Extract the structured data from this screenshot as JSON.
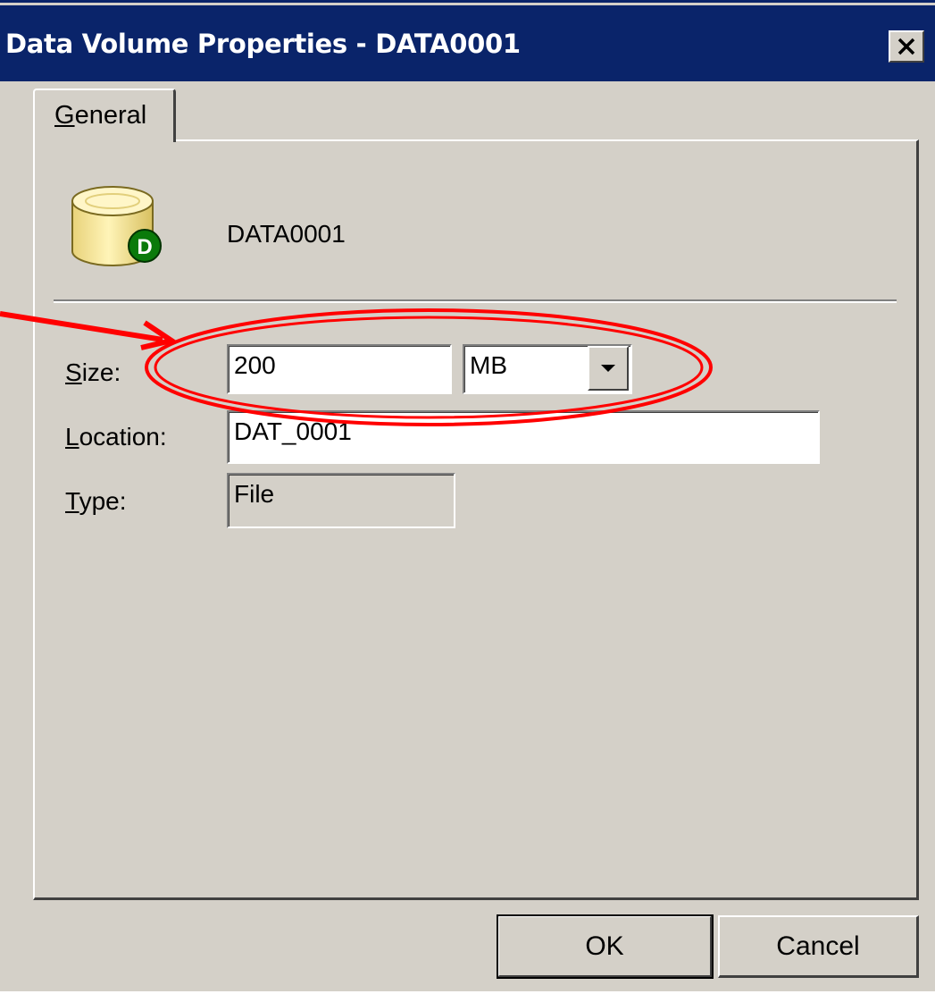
{
  "window": {
    "title": "Data Volume Properties - DATA0001",
    "close_icon": "close-x-icon"
  },
  "tabs": [
    {
      "label": "General",
      "active": true
    }
  ],
  "volume": {
    "icon": "database-volume-icon",
    "badge_letter": "D",
    "name": "DATA0001"
  },
  "fields": {
    "size": {
      "label": "Size:",
      "value": "200",
      "unit": "MB"
    },
    "location": {
      "label": "Location:",
      "value": "DAT_0001"
    },
    "type": {
      "label": "Type:",
      "value": "File"
    }
  },
  "buttons": {
    "ok": "OK",
    "cancel": "Cancel"
  },
  "annotation": {
    "shape": "ellipse-highlight",
    "color": "#ff0000",
    "target": "size-field"
  },
  "colors": {
    "titlebar": "#0a246a",
    "face": "#d4d0c8",
    "badge": "#0a7a0a"
  }
}
